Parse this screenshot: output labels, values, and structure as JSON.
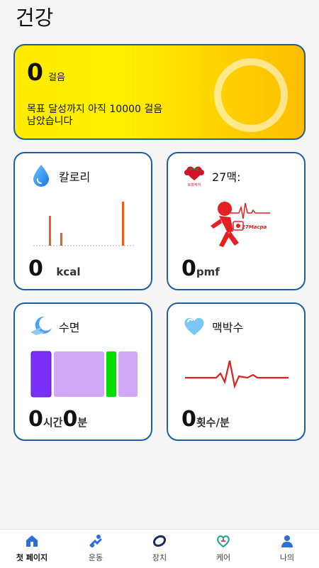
{
  "header": {
    "title": "건강"
  },
  "steps": {
    "count": "0",
    "unit": "걸음",
    "message": "목표 달성까지 아직 10000 걸음 남았습니다"
  },
  "calorie": {
    "title": "칼로리",
    "value": "0",
    "unit": "kcal",
    "icon": "water-drop-icon"
  },
  "pulse27": {
    "title": "27맥:",
    "value": "0",
    "unit": "pmf",
    "logo_text": "토혈케어",
    "figure_text": "27Macpa"
  },
  "sleep": {
    "title": "수면",
    "hours": "0",
    "hours_unit": "시간",
    "minutes": "0",
    "minutes_unit": "분",
    "icon": "moon-plane-icon"
  },
  "heart": {
    "title": "맥박수",
    "value": "0",
    "unit": "횟수/분",
    "icon": "heart-icon"
  },
  "colors": {
    "card_border": "#1a5fa8",
    "calorie_bar": "#f05a1a",
    "sleep_deep": "#7b2ff7",
    "sleep_light": "#d0a8f5",
    "sleep_awake": "#00e000",
    "heart_line": "#e0201c",
    "tab_active": "#2a6fdb"
  },
  "tabs": [
    {
      "label": "첫 페이지",
      "icon": "home-icon",
      "active": true
    },
    {
      "label": "운동",
      "icon": "exercise-icon",
      "active": false
    },
    {
      "label": "장치",
      "icon": "device-icon",
      "active": false
    },
    {
      "label": "케어",
      "icon": "care-icon",
      "active": false
    },
    {
      "label": "나의",
      "icon": "person-icon",
      "active": false
    }
  ]
}
